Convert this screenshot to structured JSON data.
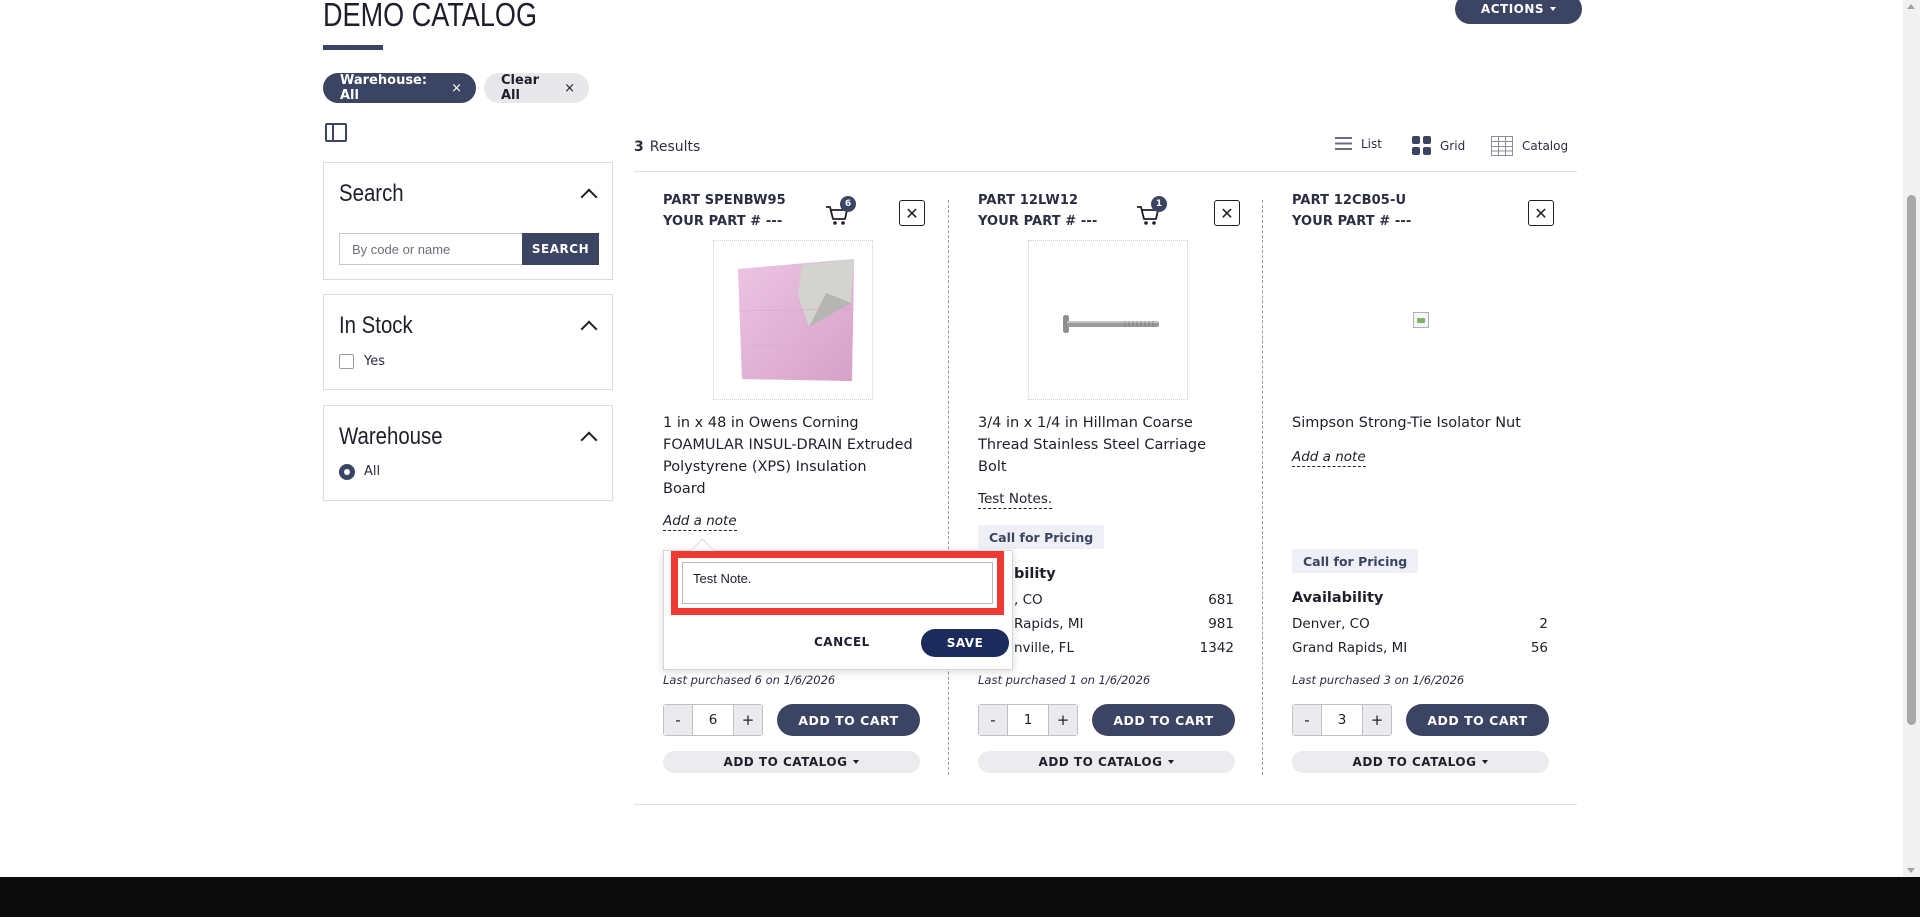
{
  "page": {
    "title": "DEMO CATALOG",
    "actions_label": "ACTIONS"
  },
  "filters": {
    "chips": [
      {
        "label": "Warehouse: All",
        "remove": "×"
      },
      {
        "label": "Clear All",
        "remove": "×"
      }
    ]
  },
  "sidebar": {
    "search": {
      "title": "Search",
      "placeholder": "By code or name",
      "button": "SEARCH"
    },
    "in_stock": {
      "title": "In Stock",
      "option": "Yes"
    },
    "warehouse": {
      "title": "Warehouse",
      "option": "All"
    }
  },
  "results": {
    "count": "3",
    "label": "Results",
    "views": {
      "list": "List",
      "grid": "Grid",
      "catalog": "Catalog"
    }
  },
  "products": [
    {
      "part": "PART SPENBW95",
      "your_part": "YOUR PART # ---",
      "cart_count": "6",
      "name": "1 in x 48 in Owens Corning FOAMULAR INSUL-DRAIN Extruded Polystyrene (XPS) Insulation Board",
      "note_link": "Add a note",
      "last_purchased": "Last purchased 6 on 1/6/2026",
      "qty": "6",
      "add_cart": "ADD TO CART",
      "add_catalog": "ADD TO CATALOG"
    },
    {
      "part": "PART 12LW12",
      "your_part": "YOUR PART # ---",
      "cart_count": "1",
      "name": "3/4 in x 1/4 in Hillman Coarse Thread Stainless Steel Carriage Bolt",
      "note": "Test Notes.",
      "pricing": "Call for Pricing",
      "availability_title": "bility",
      "availability": [
        {
          "loc": ", CO",
          "qty": "681"
        },
        {
          "loc": "Rapids, MI",
          "qty": "981"
        },
        {
          "loc": "nville, FL",
          "qty": "1342"
        }
      ],
      "last_purchased": "Last purchased 1 on 1/6/2026",
      "qty": "1",
      "add_cart": "ADD TO CART",
      "add_catalog": "ADD TO CATALOG"
    },
    {
      "part": "PART 12CB05-U",
      "your_part": "YOUR PART # ---",
      "name": "Simpson Strong-Tie Isolator Nut",
      "note_link": "Add a note",
      "pricing": "Call for Pricing",
      "availability_title": "Availability",
      "availability": [
        {
          "loc": "Denver, CO",
          "qty": "2"
        },
        {
          "loc": "Grand Rapids, MI",
          "qty": "56"
        }
      ],
      "last_purchased": "Last purchased 3 on 1/6/2026",
      "qty": "3",
      "add_cart": "ADD TO CART",
      "add_catalog": "ADD TO CATALOG"
    }
  ],
  "note_editor": {
    "value": "Test Note.",
    "cancel": "CANCEL",
    "save": "SAVE"
  },
  "colors": {
    "primary": "#3b4462",
    "save": "#1b2b5b",
    "highlight": "#ef3a33"
  }
}
